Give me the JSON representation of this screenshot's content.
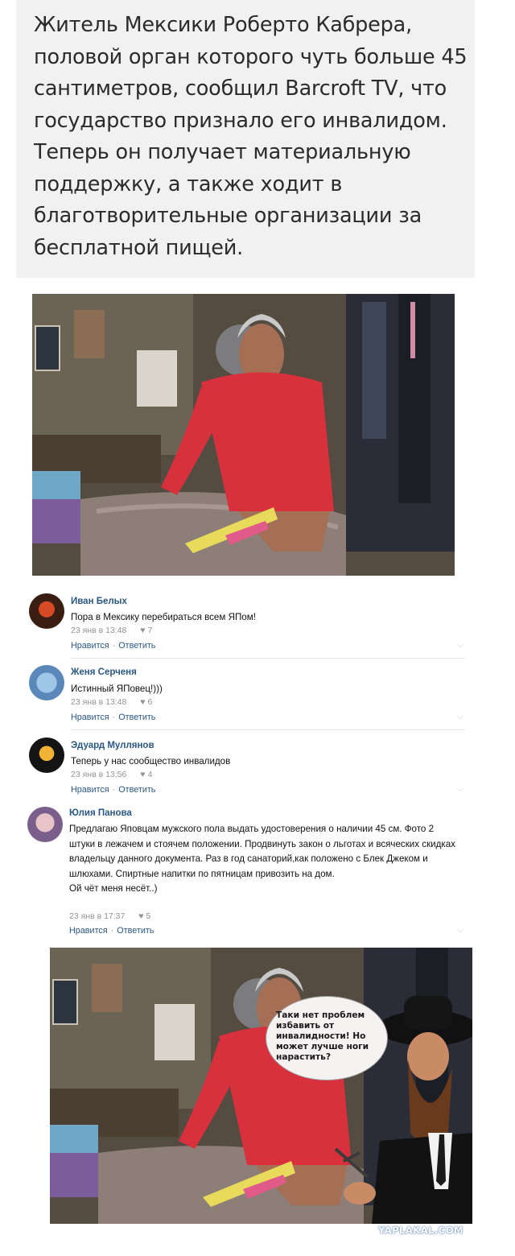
{
  "news": {
    "text": "Житель Мексики Роберто Кабрера, половой орган которого чуть больше 45 сантиметров, сообщил Barcroft TV, что государство признало его инвалидом. Теперь он получает материальную поддержку, а также ходит в благотворительные организации за бесплатной пищей."
  },
  "comments": [
    {
      "author": "Иван Белых",
      "text": "Пора в Мексику перебираться всем ЯПом!",
      "date": "23 янв в 13:48",
      "likes": "7",
      "like_label": "Нравится",
      "reply_label": "Ответить"
    },
    {
      "author": "Женя Серченя",
      "text": "Истинный ЯПовец!)))",
      "date": "23 янв в 13:48",
      "likes": "6",
      "like_label": "Нравится",
      "reply_label": "Ответить"
    },
    {
      "author": "Эдуард Муллянов",
      "text": "Теперь у нас сообщество инвалидов",
      "date": "23 янв в 13:56",
      "likes": "4",
      "like_label": "Нравится",
      "reply_label": "Ответить"
    },
    {
      "author": "Юлия Панова",
      "text": "Предлагаю Яповцам мужского пола выдать удостоверения о наличии 45 см. Фото 2 штуки в лежачем и стоячем положении. Продвинуть закон о льготах и всяческих скидках владельцу данного документа. Раз в год санаторий,как положено с Блек Джеком и шлюхами. Спиртные напитки по пятницам привозить на дом.\nОй чёт меня несёт..)",
      "date": "23 янв в 17:37",
      "likes": "5",
      "like_label": "Нравится",
      "reply_label": "Ответить"
    }
  ],
  "meme": {
    "bubble_text": "Таки нет проблем избавить от инвалидности! Но может лучше ноги нарастить?"
  },
  "watermark": "YAPLAKAL.COM",
  "icons": {
    "heart": "heart-icon",
    "chevron": "chevron-down-icon"
  },
  "colors": {
    "link": "#2a5885",
    "meta": "#939393",
    "shirt": "#d8303d"
  }
}
